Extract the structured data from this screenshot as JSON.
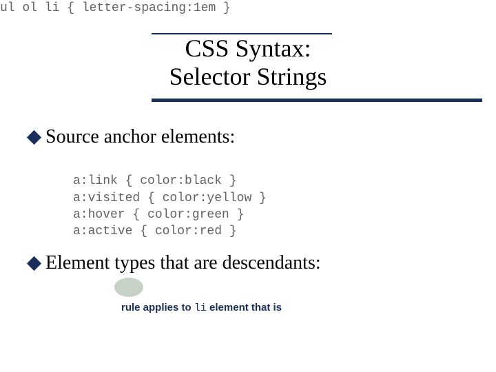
{
  "title": {
    "line1": "CSS Syntax:",
    "line2": "Selector Strings"
  },
  "bullets": [
    {
      "text": "Source anchor elements:"
    },
    {
      "text": "Element types that are descendants:"
    }
  ],
  "code1": {
    "l1": "a:link { color:black }",
    "l2": "a:visited { color:yellow }",
    "l3": "a:hover { color:green }",
    "l4": "a:active { color:red }"
  },
  "code2": {
    "l1": "ul ol li { letter-spacing:1em }"
  },
  "caption": {
    "prefix": "rule applies to ",
    "code": "li",
    "suffix": " element that is"
  },
  "colors": {
    "accent": "#1b2e5a",
    "code_gray": "#616161",
    "highlight_fill": "#c6d2c6"
  }
}
